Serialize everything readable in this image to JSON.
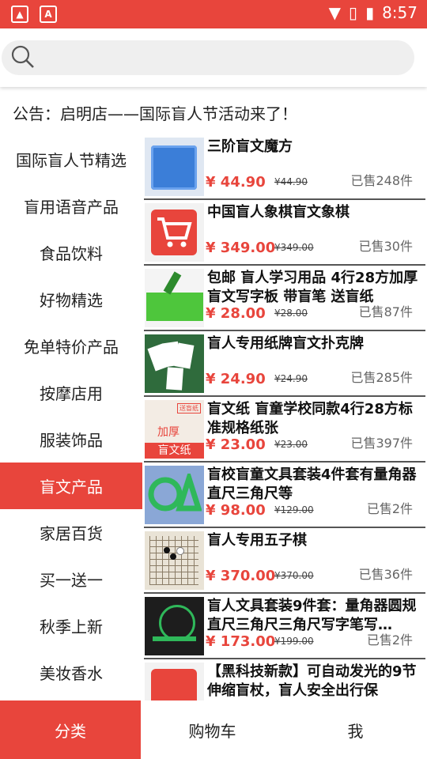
{
  "status": {
    "time": "8:57"
  },
  "notice": "公告：启明店——国际盲人节活动来了！",
  "categories": [
    "国际盲人节精选",
    "盲用语音产品",
    "食品饮料",
    "好物精选",
    "免单特价产品",
    "按摩店用",
    "服装饰品",
    "盲文产品",
    "家居百货",
    "买一送一",
    "秋季上新",
    "美妆香水"
  ],
  "active_category": "盲文产品",
  "products": [
    {
      "title": "三阶盲文魔方",
      "price": "¥ 44.90",
      "orig": "¥44.90",
      "sold": "已售248件"
    },
    {
      "title": "中国盲人象棋盲文象棋",
      "price": "¥ 349.00",
      "orig": "¥349.00",
      "sold": "已售30件"
    },
    {
      "title": "包邮 盲人学习用品 4行28方加厚盲文写字板 带盲笔 送盲纸",
      "price": "¥ 28.00",
      "orig": "¥28.00",
      "sold": "已售87件"
    },
    {
      "title": "盲人专用纸牌盲文扑克牌",
      "price": "¥ 24.90",
      "orig": "¥24.90",
      "sold": "已售285件"
    },
    {
      "title": "盲文纸 盲童学校同款4行28方标准规格纸张",
      "price": "¥ 23.00",
      "orig": "¥23.00",
      "sold": "已售397件",
      "thumb_text": "加厚",
      "thumb_badge": "盲文纸",
      "thumb_tag": "送盲纸"
    },
    {
      "title": "盲校盲童文具套装4件套有量角器直尺三角尺等",
      "price": "¥ 98.00",
      "orig": "¥129.00",
      "sold": "已售2件"
    },
    {
      "title": "盲人专用五子棋",
      "price": "¥ 370.00",
      "orig": "¥370.00",
      "sold": "已售36件"
    },
    {
      "title": "盲人文具套装9件套：量角器圆规直尺三角尺三角尺写字笔写…",
      "price": "¥ 173.00",
      "orig": "¥199.00",
      "sold": "已售2件"
    },
    {
      "title": "【黑科技新款】可自动发光的9节伸缩盲杖，盲人安全出行保",
      "price": "",
      "orig": "",
      "sold": ""
    }
  ],
  "tabs": [
    "分类",
    "购物车",
    "我"
  ],
  "colors": {
    "accent": "#e8453c"
  }
}
